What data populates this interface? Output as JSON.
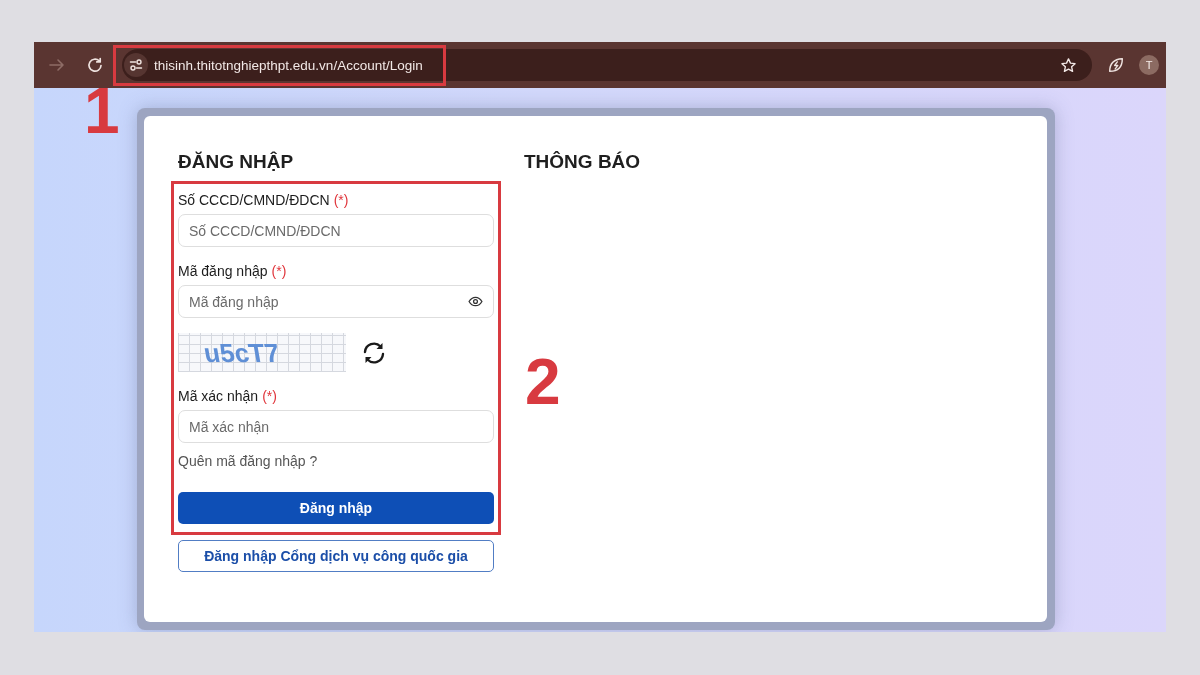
{
  "browser": {
    "forward_disabled": true,
    "address_bar": {
      "url": "thisinh.thitotnghiepthpt.edu.vn/Account/Login",
      "annotation": "1"
    },
    "profile_initial": "T"
  },
  "login": {
    "title": "ĐĂNG NHẬP",
    "annotation": "2",
    "fields": [
      {
        "kind": "text",
        "label": "Số CCCD/CMND/ĐDCN",
        "required_mark": "(*)",
        "placeholder": "Số CCCD/CMND/ĐDCN"
      },
      {
        "kind": "password",
        "label": "Mã đăng nhập",
        "required_mark": "(*)",
        "placeholder": "Mã đăng nhập"
      },
      {
        "kind": "captcha",
        "code": "u5cT7"
      },
      {
        "kind": "text",
        "label": "Mã xác nhận",
        "required_mark": "(*)",
        "placeholder": "Mã xác nhận"
      }
    ],
    "forgot_link": "Quên mã đăng nhập ?",
    "buttons": [
      {
        "kind": "primary",
        "label": "Đăng nhập"
      },
      {
        "kind": "outline",
        "label": "Đăng nhập Cổng dịch vụ công quốc gia"
      }
    ]
  },
  "notice": {
    "title": "THÔNG BÁO"
  }
}
